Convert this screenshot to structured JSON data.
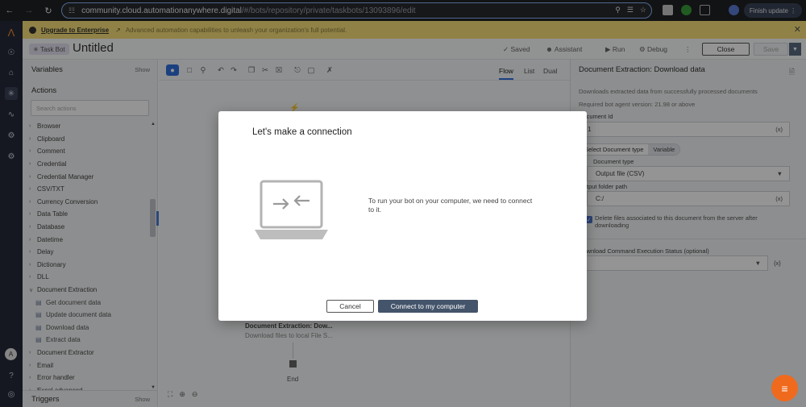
{
  "browser": {
    "url_host": "community.cloud.automationanywhere.digital",
    "url_path": "/#/bots/repository/private/taskbots/13093896/edit",
    "finish_update": "Finish update",
    "profile_initial": "A"
  },
  "banner": {
    "upgrade": "Upgrade to Enterprise",
    "message": "Advanced automation capabilities to unleash your organization's full potential."
  },
  "header": {
    "badge": "Task Bot",
    "title": "Untitled",
    "saved": "Saved",
    "assistant": "Assistant",
    "run": "Run",
    "debug": "Debug",
    "close": "Close",
    "save": "Save"
  },
  "left_panel": {
    "variables": "Variables",
    "variables_show": "Show",
    "actions": "Actions",
    "search_placeholder": "Search actions",
    "items": [
      {
        "label": "Browser",
        "type": "group"
      },
      {
        "label": "Clipboard",
        "type": "group"
      },
      {
        "label": "Comment",
        "type": "group"
      },
      {
        "label": "Credential",
        "type": "group"
      },
      {
        "label": "Credential Manager",
        "type": "group"
      },
      {
        "label": "CSV/TXT",
        "type": "group"
      },
      {
        "label": "Currency Conversion",
        "type": "group"
      },
      {
        "label": "Data Table",
        "type": "group"
      },
      {
        "label": "Database",
        "type": "group"
      },
      {
        "label": "Datetime",
        "type": "group"
      },
      {
        "label": "Delay",
        "type": "group"
      },
      {
        "label": "Dictionary",
        "type": "group"
      },
      {
        "label": "DLL",
        "type": "group"
      },
      {
        "label": "Document Extraction",
        "type": "open"
      },
      {
        "label": "Get document data",
        "type": "sub"
      },
      {
        "label": "Update document data",
        "type": "sub"
      },
      {
        "label": "Download data",
        "type": "sub"
      },
      {
        "label": "Extract data",
        "type": "sub"
      },
      {
        "label": "Document Extractor",
        "type": "group"
      },
      {
        "label": "Email",
        "type": "group"
      },
      {
        "label": "Error handler",
        "type": "group"
      },
      {
        "label": "Excel advanced",
        "type": "group"
      }
    ],
    "triggers": "Triggers",
    "triggers_show": "Show"
  },
  "canvas": {
    "views": [
      "Flow",
      "List",
      "Dual"
    ],
    "active_view": "Flow",
    "node_title": "Document Extraction: Dow...",
    "node_sub": "Download files to local File S...",
    "end_label": "End"
  },
  "right_panel": {
    "title": "Document Extraction: Download data",
    "description": "Downloads extracted data from successfully processed documents",
    "required_version": "Required bot agent version: 21.98 or above",
    "document_id_label": "Document Id",
    "document_id_value": "1",
    "var_btn": "(x)",
    "toggle_select": "Select Document type",
    "toggle_variable": "Variable",
    "document_type_label": "Document type",
    "document_type_value": "Output file (CSV)",
    "output_folder_label": "Output folder path",
    "output_folder_value": "C:/",
    "delete_files_label": "Delete files associated to this document from the server after downloading",
    "status_label": "Download Command Execution Status (optional)",
    "status_var_btn": "{x}"
  },
  "modal": {
    "title": "Let's make a connection",
    "message": "To run your bot on your computer, we need to connect to it.",
    "cancel": "Cancel",
    "connect": "Connect to my computer"
  },
  "colors": {
    "accent": "#2f6fdb",
    "banner": "#f9e079",
    "rail": "#262a3a",
    "connect_button": "#44546a",
    "help_button": "#f06a1d"
  }
}
